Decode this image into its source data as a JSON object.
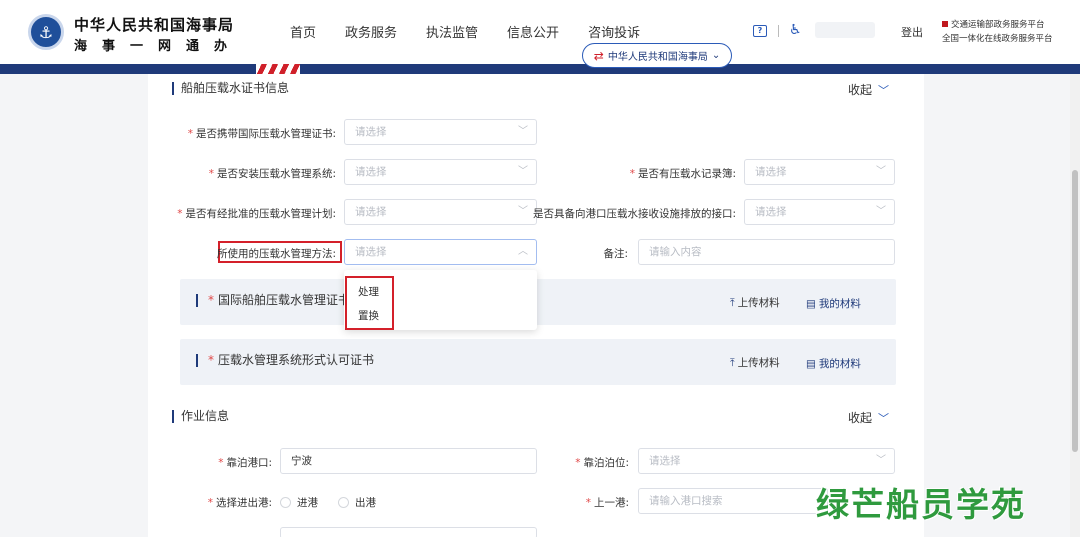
{
  "header": {
    "brand_title": "中华人民共和国海事局",
    "brand_sub": "海事一网通办",
    "nav": [
      "首页",
      "政务服务",
      "执法监管",
      "信息公开",
      "咨询投诉"
    ],
    "dept_selector": "中华人民共和国海事局",
    "logout": "登出",
    "platform_line1": "交通运输部政务服务平台",
    "platform_line2": "全国一体化在线政务服务平台"
  },
  "ballast_section": {
    "title": "船舶压载水证书信息",
    "collapse_label": "收起",
    "fields": {
      "carry_cert_label": "是否携带国际压载水管理证书:",
      "carry_cert_value": "请选择",
      "install_system_label": "是否安装压载水管理系统:",
      "install_system_value": "请选择",
      "record_book_label": "是否有压载水记录簿:",
      "record_book_value": "请选择",
      "approved_plan_label": "是否有经批准的压载水管理计划:",
      "approved_plan_value": "请选择",
      "port_interface_label": "是否具备向港口压载水接收设施排放的接口:",
      "port_interface_value": "请选择",
      "method_label": "所使用的压载水管理方法:",
      "method_value": "请选择",
      "remark_label": "备注:",
      "remark_placeholder": "请输入内容"
    },
    "method_options": [
      "处理",
      "置换"
    ]
  },
  "uploads": [
    {
      "title": "国际船舶压载水管理证书",
      "upload_label": "上传材料",
      "materials_label": "我的材料"
    },
    {
      "title": "压载水管理系统形式认可证书",
      "upload_label": "上传材料",
      "materials_label": "我的材料"
    }
  ],
  "operation_section": {
    "title": "作业信息",
    "collapse_label": "收起",
    "berth_port_label": "靠泊港口:",
    "berth_port_value": "宁波",
    "berth_position_label": "靠泊泊位:",
    "berth_position_value": "请选择",
    "inout_label": "选择进出港:",
    "inout_options": [
      "进港",
      "出港"
    ],
    "prev_port_label": "上一港:",
    "prev_port_placeholder": "请输入港口搜索"
  },
  "watermark": "绿芒船员学苑",
  "colors": {
    "brand_navy": "#1f3a7a",
    "required_red": "#e04848",
    "highlight_red": "#d4202a"
  }
}
